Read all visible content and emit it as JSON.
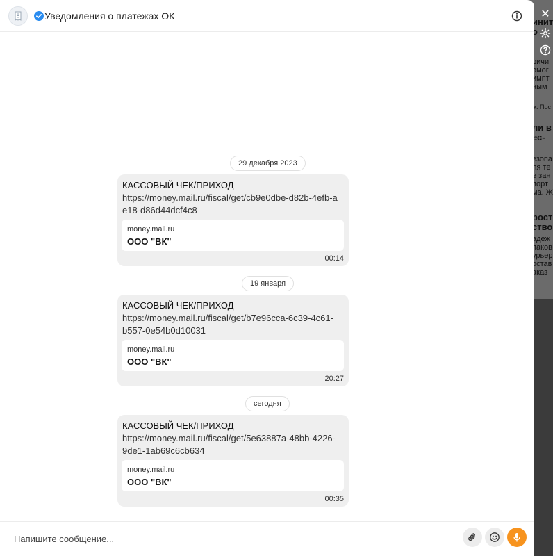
{
  "header": {
    "title": "Уведомления о платежах ОК",
    "info_icon": "info-icon",
    "verified_icon": "verified-check-icon"
  },
  "messages": [
    {
      "date": "29 декабря 2023",
      "title": "КАССОВЫЙ ЧЕК/ПРИХОД",
      "link": "https://money.mail.ru/fiscal/get/cb9e0dbe-d82b-4efb-ae18-d86d44dcf4c8",
      "card_domain": "money.mail.ru",
      "card_company": "ООО \"ВК\"",
      "time": "00:14"
    },
    {
      "date": "19 января",
      "title": "КАССОВЫЙ ЧЕК/ПРИХОД",
      "link": "https://money.mail.ru/fiscal/get/b7e96cca-6c39-4c61-b557-0e54b0d10031",
      "card_domain": "money.mail.ru",
      "card_company": "ООО \"ВК\"",
      "time": "20:27"
    },
    {
      "date": "сегодня",
      "title": "КАССОВЫЙ ЧЕК/ПРИХОД",
      "link": "https://money.mail.ru/fiscal/get/5e63887a-48bb-4226-9de1-1ab69c6cb634",
      "card_domain": "money.mail.ru",
      "card_company": "ООО \"ВК\"",
      "time": "00:35"
    }
  ],
  "composer": {
    "placeholder": "Напишите сообщение..."
  },
  "background_fragments": [
    "ините",
    "о",
    "ричи",
    "омог",
    "импт",
    "ным",
    "ж. Пос",
    "ли в т",
    "ес-",
    "езопа",
    "ля те",
    "е зан",
    "порт",
    "ма. Ж",
    "рост",
    "ство",
    "адеж",
    "паков",
    "урьер",
    "остав",
    "аказ"
  ],
  "colors": {
    "accent": "#f7931e",
    "verified": "#2a8cf0",
    "bubble": "#efefef"
  }
}
